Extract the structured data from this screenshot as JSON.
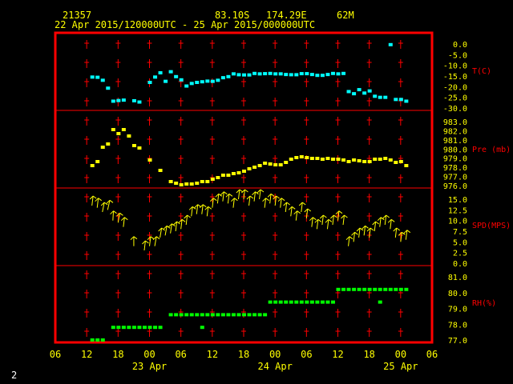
{
  "header": {
    "station_id": "21357",
    "lat": "83.10S",
    "lon": "174.29E",
    "elev": "62M",
    "time_range": "22 Apr 2015/120000UTC - 25 Apr 2015/000000UTC"
  },
  "footer": {
    "page_number": "2"
  },
  "colors": {
    "frame": "#ff0000",
    "axis_text": "#ffff00",
    "temp": "#00ffff",
    "pressure": "#ffff00",
    "wind": "#ffff00",
    "rh": "#00ff00",
    "grid": "#ff0000",
    "series_label": "#ff0000"
  },
  "chart_data": {
    "type": "scatter",
    "grid": true,
    "x_axis": {
      "hour_ticks": [
        "06",
        "12",
        "18",
        "00",
        "06",
        "12",
        "18",
        "00",
        "06",
        "12",
        "18",
        "00",
        "06"
      ],
      "date_labels": [
        {
          "label": "23 Apr",
          "at": "23 Apr 00UTC"
        },
        {
          "label": "24 Apr",
          "at": "24 Apr 00UTC"
        },
        {
          "label": "25 Apr",
          "at": "25 Apr 00UTC"
        }
      ]
    },
    "panels": [
      {
        "id": "temp",
        "label": "T(C)",
        "color": "#00ffff",
        "marker": "square",
        "ylim": [
          -30,
          0
        ],
        "ticks": [
          "0.0",
          "-5.0",
          "-10.0",
          "-15.0",
          "-20.0",
          "-25.0",
          "-30.0"
        ],
        "points": [
          [
            13,
            -15.5
          ],
          [
            14,
            -15.6
          ],
          [
            15,
            -17
          ],
          [
            16,
            -20.7
          ],
          [
            17,
            -26.8
          ],
          [
            18,
            -26.5
          ],
          [
            19,
            -26.3
          ],
          [
            21,
            -26.6
          ],
          [
            22,
            -27.2
          ],
          [
            24,
            -18
          ],
          [
            25,
            -15.5
          ],
          [
            26,
            -13.5
          ],
          [
            27,
            -17.5
          ],
          [
            28,
            -13
          ],
          [
            29,
            -15.3
          ],
          [
            30,
            -16.8
          ],
          [
            31,
            -19.7
          ],
          [
            32,
            -18.5
          ],
          [
            33,
            -18
          ],
          [
            34,
            -17.7
          ],
          [
            35,
            -17.4
          ],
          [
            36,
            -17.5
          ],
          [
            37,
            -17
          ],
          [
            38,
            -15.8
          ],
          [
            39,
            -15.3
          ],
          [
            40,
            -14
          ],
          [
            41,
            -14.4
          ],
          [
            42,
            -14.5
          ],
          [
            43,
            -14.5
          ],
          [
            44,
            -13.8
          ],
          [
            45,
            -14
          ],
          [
            46,
            -13.9
          ],
          [
            47,
            -13.8
          ],
          [
            48,
            -14
          ],
          [
            49,
            -14
          ],
          [
            50,
            -14.3
          ],
          [
            51,
            -14.4
          ],
          [
            52,
            -14.4
          ],
          [
            53,
            -13.9
          ],
          [
            54,
            -13.9
          ],
          [
            55,
            -14.3
          ],
          [
            56,
            -14.7
          ],
          [
            57,
            -14.7
          ],
          [
            58,
            -14.3
          ],
          [
            59,
            -13.8
          ],
          [
            60,
            -14
          ],
          [
            61,
            -13.8
          ],
          [
            62,
            -22.3
          ],
          [
            63,
            -23.3
          ],
          [
            64,
            -21.4
          ],
          [
            65,
            -23
          ],
          [
            66,
            -22
          ],
          [
            67,
            -24.5
          ],
          [
            68,
            -25
          ],
          [
            69,
            -25
          ],
          [
            70,
            -0.3
          ],
          [
            71,
            -26
          ],
          [
            72,
            -26
          ],
          [
            73,
            -26.8
          ]
        ]
      },
      {
        "id": "pressure",
        "label": "Pre (mb)",
        "color": "#ffff00",
        "marker": "square",
        "ylim": [
          976,
          984
        ],
        "ticks": [
          "983.0",
          "982.0",
          "981.0",
          "980.0",
          "979.0",
          "978.0",
          "977.0",
          "976.0"
        ],
        "points": [
          [
            13,
            978.5
          ],
          [
            14,
            979
          ],
          [
            15,
            980.8
          ],
          [
            16,
            981.2
          ],
          [
            17,
            983
          ],
          [
            18,
            982.5
          ],
          [
            19,
            983
          ],
          [
            20,
            982.2
          ],
          [
            21,
            981
          ],
          [
            22,
            980.7
          ],
          [
            24,
            979.2
          ],
          [
            26,
            977.9
          ],
          [
            28,
            976.5
          ],
          [
            29,
            976.3
          ],
          [
            30,
            976.1
          ],
          [
            31,
            976.2
          ],
          [
            32,
            976.2
          ],
          [
            33,
            976.3
          ],
          [
            34,
            976.5
          ],
          [
            35,
            976.5
          ],
          [
            36,
            976.8
          ],
          [
            37,
            977
          ],
          [
            38,
            977.3
          ],
          [
            39,
            977.3
          ],
          [
            40,
            977.5
          ],
          [
            41,
            977.6
          ],
          [
            42,
            977.8
          ],
          [
            43,
            978.1
          ],
          [
            44,
            978.3
          ],
          [
            45,
            978.5
          ],
          [
            46,
            978.8
          ],
          [
            47,
            978.7
          ],
          [
            48,
            978.6
          ],
          [
            49,
            978.6
          ],
          [
            50,
            978.9
          ],
          [
            51,
            979.3
          ],
          [
            52,
            979.5
          ],
          [
            53,
            979.6
          ],
          [
            54,
            979.5
          ],
          [
            55,
            979.4
          ],
          [
            56,
            979.4
          ],
          [
            57,
            979.3
          ],
          [
            58,
            979.4
          ],
          [
            59,
            979.3
          ],
          [
            60,
            979.3
          ],
          [
            61,
            979.2
          ],
          [
            62,
            979
          ],
          [
            63,
            979.2
          ],
          [
            64,
            979.1
          ],
          [
            65,
            979
          ],
          [
            66,
            979
          ],
          [
            67,
            979.3
          ],
          [
            68,
            979.3
          ],
          [
            69,
            979.4
          ],
          [
            70,
            979.2
          ],
          [
            71,
            978.9
          ],
          [
            72,
            979
          ],
          [
            73,
            978.5
          ]
        ]
      },
      {
        "id": "wind",
        "label": "SPD(MPS)",
        "color": "#ffff00",
        "marker": "arrow",
        "ylim": [
          0,
          15
        ],
        "ticks": [
          "15.0",
          "12.5",
          "10.0",
          "7.5",
          "5.0",
          "2.5",
          "0.0"
        ],
        "points": [
          [
            13,
            13.5,
            200
          ],
          [
            14,
            13,
            200
          ],
          [
            15,
            12,
            215
          ],
          [
            16,
            12.5,
            220
          ],
          [
            17,
            10,
            190
          ],
          [
            18,
            9.5,
            210
          ],
          [
            19,
            8.5,
            200
          ],
          [
            21,
            4,
            180
          ],
          [
            23,
            3,
            200
          ],
          [
            24,
            4,
            200
          ],
          [
            25,
            4,
            210
          ],
          [
            26,
            6,
            210
          ],
          [
            27,
            6.5,
            210
          ],
          [
            28,
            7,
            205
          ],
          [
            29,
            7.5,
            200
          ],
          [
            30,
            8,
            200
          ],
          [
            31,
            9,
            200
          ],
          [
            32,
            11,
            200
          ],
          [
            33,
            11.5,
            200
          ],
          [
            34,
            11.5,
            200
          ],
          [
            35,
            11,
            200
          ],
          [
            36,
            13,
            200
          ],
          [
            37,
            14,
            200
          ],
          [
            38,
            14.5,
            200
          ],
          [
            39,
            14,
            200
          ],
          [
            40,
            13,
            200
          ],
          [
            41,
            15,
            200
          ],
          [
            42,
            15,
            200
          ],
          [
            43,
            13.5,
            200
          ],
          [
            44,
            14.5,
            200
          ],
          [
            45,
            15,
            200
          ],
          [
            46,
            13,
            200
          ],
          [
            47,
            14,
            200
          ],
          [
            48,
            13.5,
            200
          ],
          [
            49,
            13,
            200
          ],
          [
            50,
            12,
            200
          ],
          [
            51,
            11,
            200
          ],
          [
            52,
            10,
            200
          ],
          [
            53,
            12,
            200
          ],
          [
            54,
            10.5,
            200
          ],
          [
            55,
            8.5,
            200
          ],
          [
            56,
            8,
            200
          ],
          [
            57,
            9,
            200
          ],
          [
            58,
            8,
            200
          ],
          [
            59,
            9,
            200
          ],
          [
            60,
            10,
            200
          ],
          [
            61,
            9,
            200
          ],
          [
            62,
            4,
            200
          ],
          [
            63,
            5,
            200
          ],
          [
            64,
            6,
            200
          ],
          [
            65,
            6.5,
            200
          ],
          [
            66,
            6,
            200
          ],
          [
            67,
            7.5,
            200
          ],
          [
            68,
            8.5,
            200
          ],
          [
            69,
            9,
            200
          ],
          [
            70,
            8,
            200
          ],
          [
            71,
            6,
            200
          ],
          [
            72,
            5,
            200
          ],
          [
            73,
            5.5,
            200
          ]
        ]
      },
      {
        "id": "rh",
        "label": "RH(%)",
        "color": "#00ff00",
        "marker": "square",
        "ylim": [
          77,
          82
        ],
        "ticks": [
          "81.0",
          "80.0",
          "79.0",
          "78.0",
          "77.0"
        ],
        "points": [
          [
            13,
            77
          ],
          [
            14,
            77
          ],
          [
            15,
            77
          ],
          [
            17,
            78
          ],
          [
            18,
            78
          ],
          [
            19,
            78
          ],
          [
            20,
            78
          ],
          [
            21,
            78
          ],
          [
            22,
            78
          ],
          [
            23,
            78
          ],
          [
            24,
            78
          ],
          [
            25,
            78
          ],
          [
            26,
            78
          ],
          [
            28,
            79
          ],
          [
            29,
            79
          ],
          [
            30,
            79
          ],
          [
            31,
            79
          ],
          [
            32,
            79
          ],
          [
            33,
            79
          ],
          [
            34,
            79
          ],
          [
            35,
            79
          ],
          [
            36,
            79
          ],
          [
            37,
            79
          ],
          [
            38,
            79
          ],
          [
            39,
            79
          ],
          [
            40,
            79
          ],
          [
            41,
            79
          ],
          [
            42,
            79
          ],
          [
            43,
            79
          ],
          [
            44,
            79
          ],
          [
            45,
            79
          ],
          [
            46,
            79
          ],
          [
            34,
            78
          ],
          [
            47,
            80
          ],
          [
            48,
            80
          ],
          [
            49,
            80
          ],
          [
            50,
            80
          ],
          [
            51,
            80
          ],
          [
            52,
            80
          ],
          [
            53,
            80
          ],
          [
            54,
            80
          ],
          [
            55,
            80
          ],
          [
            56,
            80
          ],
          [
            57,
            80
          ],
          [
            58,
            80
          ],
          [
            59,
            80
          ],
          [
            60,
            81
          ],
          [
            61,
            81
          ],
          [
            62,
            81
          ],
          [
            63,
            81
          ],
          [
            64,
            81
          ],
          [
            65,
            81
          ],
          [
            66,
            81
          ],
          [
            67,
            81
          ],
          [
            68,
            81
          ],
          [
            69,
            81
          ],
          [
            70,
            81
          ],
          [
            71,
            81
          ],
          [
            72,
            81
          ],
          [
            73,
            81
          ],
          [
            68,
            80
          ]
        ]
      }
    ]
  }
}
